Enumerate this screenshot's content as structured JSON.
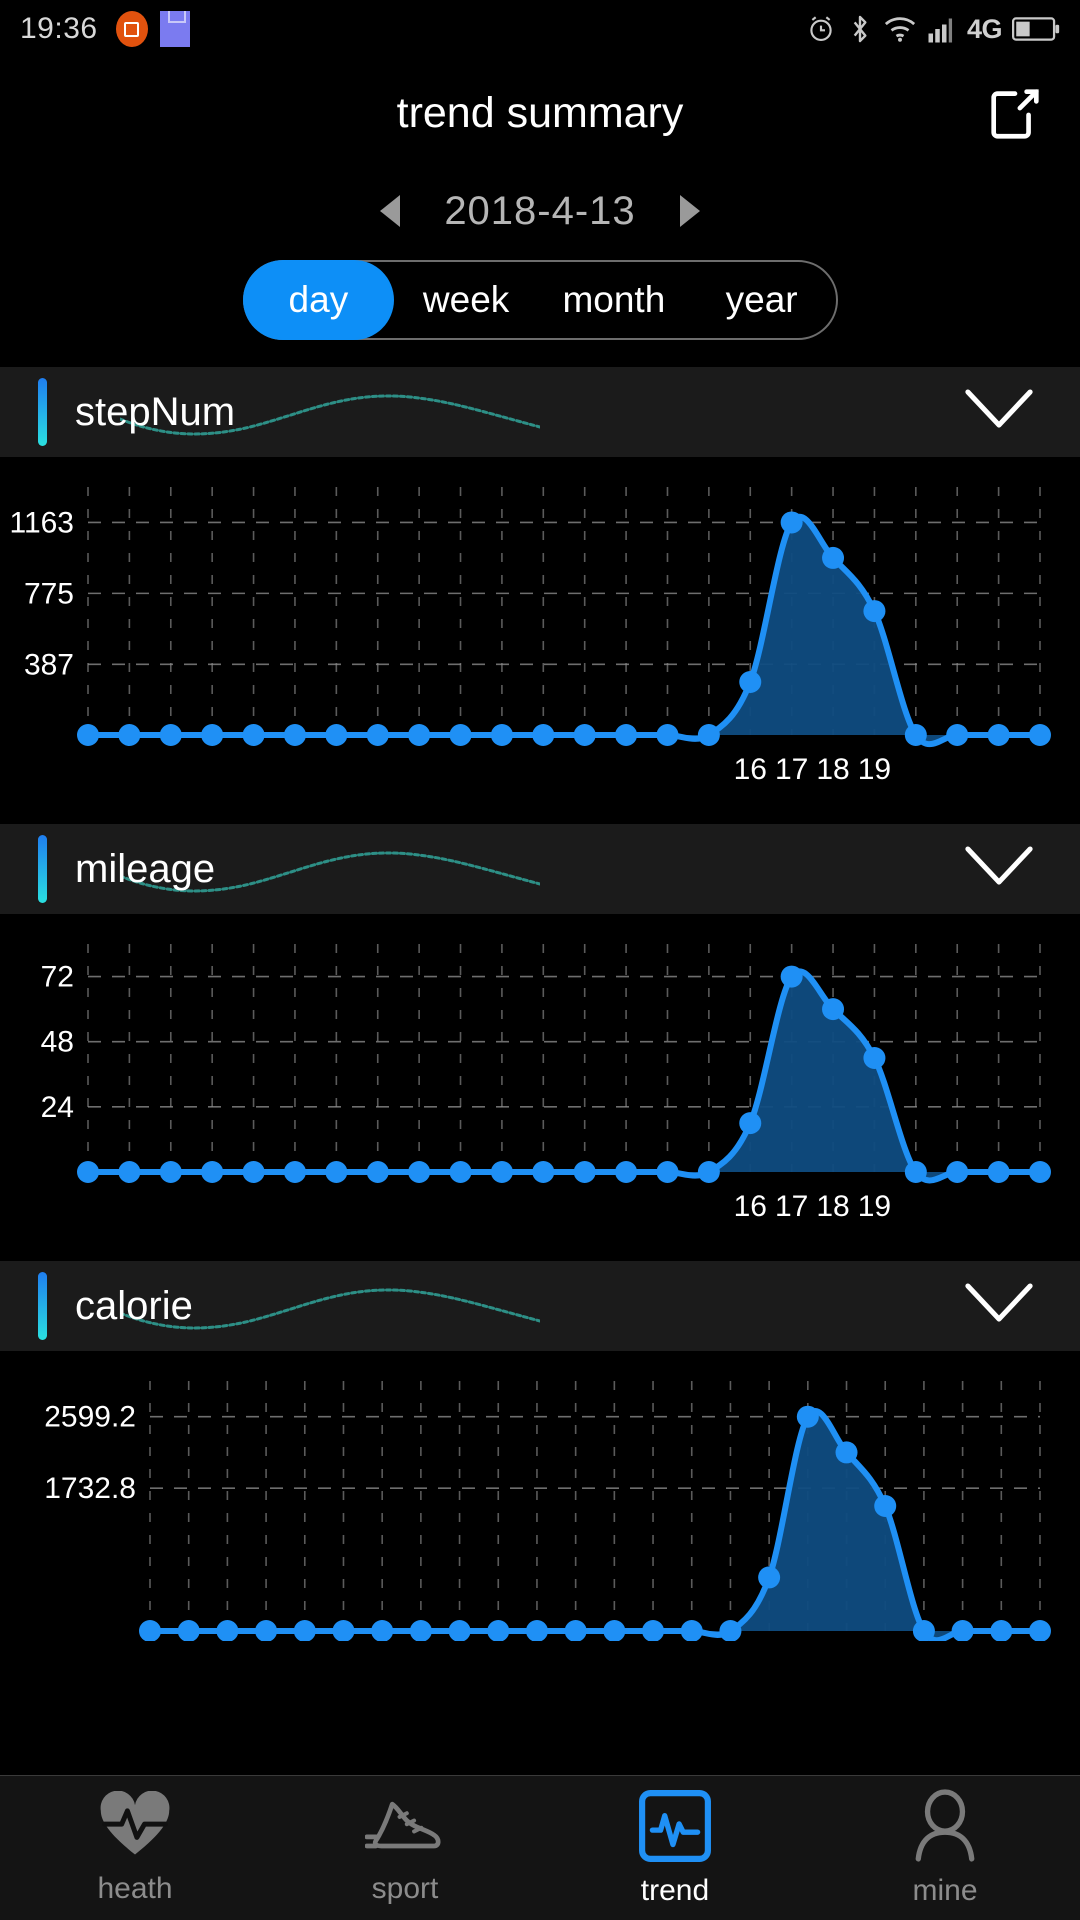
{
  "status_bar": {
    "time": "19:36",
    "network": "4G",
    "icons": [
      "screen-record-icon",
      "sd-card-icon",
      "alarm-icon",
      "bluetooth-icon",
      "wifi-icon",
      "signal-icon",
      "battery-icon"
    ]
  },
  "header": {
    "title": "trend summary",
    "share_icon": "share-external-icon"
  },
  "date_nav": {
    "prev_icon": "chevron-left-icon",
    "date": "2018-4-13",
    "next_icon": "chevron-right-icon"
  },
  "range_tabs": {
    "selected": "day",
    "accent": "#0d8ff7",
    "items": [
      {
        "label": "day",
        "active": true
      },
      {
        "label": "week",
        "active": false
      },
      {
        "label": "month",
        "active": false
      },
      {
        "label": "year",
        "active": false
      }
    ]
  },
  "sections": [
    {
      "title": "stepNum",
      "chevron": "chevron-down-icon"
    },
    {
      "title": "mileage",
      "chevron": "chevron-down-icon"
    },
    {
      "title": "calorie",
      "chevron": "chevron-down-icon"
    }
  ],
  "bottom_nav": {
    "items": [
      {
        "label": "heath",
        "icon": "heart-pulse-icon",
        "active": false
      },
      {
        "label": "sport",
        "icon": "shoe-icon",
        "active": false
      },
      {
        "label": "trend",
        "icon": "pulse-chart-icon",
        "active": true
      },
      {
        "label": "mine",
        "icon": "person-icon",
        "active": false
      }
    ]
  },
  "chart_data": [
    {
      "type": "area",
      "title": "stepNum",
      "xlabel": "",
      "ylabel": "",
      "yticks": [
        387,
        775,
        1163
      ],
      "ylim": [
        0,
        1357
      ],
      "xticks": [
        16,
        17,
        18,
        19
      ],
      "xtick_labels": [
        "16",
        "17",
        "18",
        "19"
      ],
      "grid": true,
      "line_color": "#1f90f5",
      "fill_color": "#0f4c81",
      "x": [
        0,
        1,
        2,
        3,
        4,
        5,
        6,
        7,
        8,
        9,
        10,
        11,
        12,
        13,
        14,
        15,
        16,
        17,
        18,
        19,
        20,
        21,
        22,
        23
      ],
      "values": [
        0,
        0,
        0,
        0,
        0,
        0,
        0,
        0,
        0,
        0,
        0,
        0,
        0,
        0,
        0,
        0,
        290,
        1163,
        969,
        678,
        0,
        0,
        0,
        0
      ]
    },
    {
      "type": "area",
      "title": "mileage",
      "xlabel": "",
      "ylabel": "",
      "yticks": [
        24,
        48,
        72
      ],
      "ylim": [
        0,
        84
      ],
      "xticks": [
        16,
        17,
        18,
        19
      ],
      "xtick_labels": [
        "16",
        "17",
        "18",
        "19"
      ],
      "grid": true,
      "line_color": "#1f90f5",
      "fill_color": "#0f4c81",
      "x": [
        0,
        1,
        2,
        3,
        4,
        5,
        6,
        7,
        8,
        9,
        10,
        11,
        12,
        13,
        14,
        15,
        16,
        17,
        18,
        19,
        20,
        21,
        22,
        23
      ],
      "values": [
        0,
        0,
        0,
        0,
        0,
        0,
        0,
        0,
        0,
        0,
        0,
        0,
        0,
        0,
        0,
        0,
        18,
        72,
        60,
        42,
        0,
        0,
        0,
        0
      ]
    },
    {
      "type": "area",
      "title": "calorie",
      "xlabel": "",
      "ylabel": "",
      "yticks": [
        1732.8,
        2599.2
      ],
      "ytick_labels": [
        "1732.8",
        "2599.2"
      ],
      "ylim": [
        0,
        3032.4
      ],
      "xticks": [],
      "xtick_labels": [],
      "grid": true,
      "line_color": "#1f90f5",
      "fill_color": "#0f4c81",
      "x": [
        0,
        1,
        2,
        3,
        4,
        5,
        6,
        7,
        8,
        9,
        10,
        11,
        12,
        13,
        14,
        15,
        16,
        17,
        18,
        19,
        20,
        21,
        22,
        23
      ],
      "values": [
        0,
        0,
        0,
        0,
        0,
        0,
        0,
        0,
        0,
        0,
        0,
        0,
        0,
        0,
        0,
        0,
        650,
        2599.2,
        2166,
        1516,
        0,
        0,
        0,
        0
      ]
    }
  ]
}
